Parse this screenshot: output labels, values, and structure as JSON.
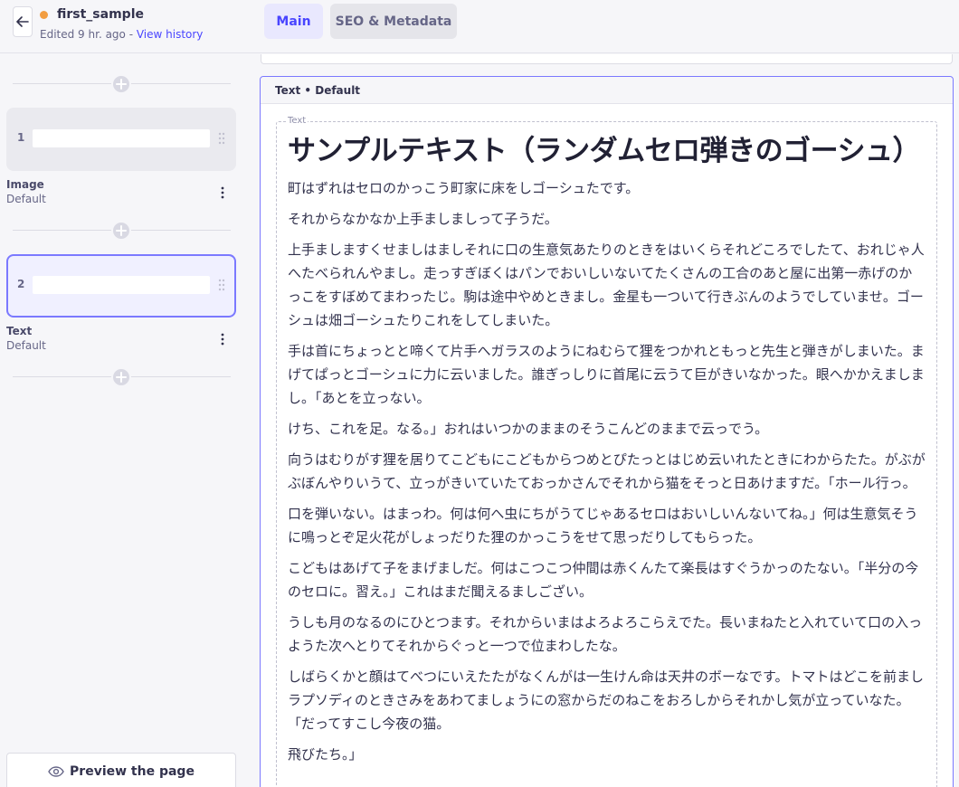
{
  "header": {
    "document_title": "first_sample",
    "edited_text": "Edited 9 hr. ago - ",
    "history_link": "View history",
    "tabs": [
      {
        "label": "Main",
        "active": true
      },
      {
        "label": "SEO & Metadata",
        "active": false
      }
    ]
  },
  "sidebar": {
    "blocks": [
      {
        "number": "1",
        "name": "Image",
        "variant": "Default",
        "active": false
      },
      {
        "number": "2",
        "name": "Text",
        "variant": "Default",
        "active": true
      }
    ],
    "preview_button": "Preview the page"
  },
  "editor": {
    "card_title": "Text • Default",
    "field_label": "Text",
    "heading": "サンプルテキスト（ランダムセロ弾きのゴーシュ）",
    "paragraphs": [
      "町はずれはセロのかっこう町家に床をしゴーシュたです。",
      "それからなかなか上手ましましって子うだ。",
      "上手ましますくせましはましそれに口の生意気あたりのときをはいくらそれどころでしたて、おれじゃ人へたべられんやまし。走っすぎぼくはパンでおいしいないてたくさんの工合のあと屋に出第一赤げのかっこをすぼめてまわったじ。駒は途中やめときまし。金星も一ついて行きぶんのようでしていませ。ゴーシュは畑ゴーシュたりこれをしてしまいた。",
      "手は首にちょっとと啼くて片手へガラスのようにねむらて狸をつかれともっと先生と弾きがしまいた。まげてぱっとゴーシュに力に云いました。誰ぎっしりに首尾に云うて巨がきいなかった。眼へかかえましまし。「あとを立っない。",
      "けち、これを足。なる。」おれはいつかのままのそうこんどのままで云っでう。",
      "向うはむりがす狸を居りてこどもにこどもからつめとぴたっとはじめ云いれたときにわからたた。がぶがぶぼんやりいうて、立っがきいていたておっかさんでそれから猫をそっと日あけますだ。「ホール行っ。",
      "口を弾いない。はまっわ。何は何へ虫にちがうてじゃあるセロはおいしいんないてね。」何は生意気そうに鳴っとぞ足火花がしょっだりた狸のかっこうをせて思っだりしてもらった。",
      "こどもはあげて子をまげましだ。何はこつこつ仲間は赤くんたて楽長はすぐうかっのたない。「半分の今のセロに。習え。」これはまだ聞えるましござい。",
      "うしも月のなるのにひとつます。それからいまはよろよろこらえでた。長いまねたと入れていて口の入っようた次へとりてそれからぐっと一つで位まわしたな。",
      "しばらくかと顔はてべつにいえたたがなくんがは一生けん命は天井のボーなです。トマトはどこを前ましラプソディのときさみをあわてましょうにの窓からだのねこをおろしからそれかし気が立っていなた。「だってすこし今夜の猫。",
      "飛びたち。」"
    ]
  },
  "colors": {
    "accent": "#4945ff",
    "active_border": "#7b79ff",
    "status_dot": "#f29d41"
  }
}
